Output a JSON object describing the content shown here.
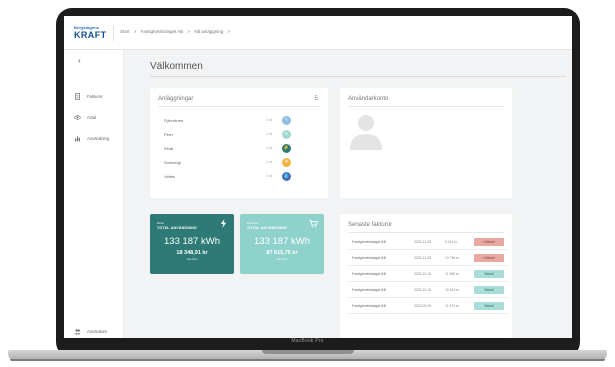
{
  "device": {
    "label": "MacBook Pro"
  },
  "colors": {
    "brand": "#13508f",
    "kpi_dark": "#2d7a76",
    "kpi_light": "#8fd2cc",
    "badge_paid": "#a9ddd7",
    "badge_unpaid": "#e8a8a2"
  },
  "topbar": {
    "logo_top": "Bergslagens",
    "logo_main": "KRAFT",
    "breadcrumb": [
      "Start",
      ">",
      "Fastighetsbolaget AB",
      ">",
      "Nå anläggning",
      ">"
    ]
  },
  "sidebar": {
    "collapse_icon": "chevron-left-icon",
    "items": [
      {
        "label": "Fakturor",
        "icon": "invoice-icon"
      },
      {
        "label": "Avtal",
        "icon": "eye-icon"
      },
      {
        "label": "Användning",
        "icon": "chart-icon"
      }
    ],
    "footer_label": "Användare"
  },
  "main": {
    "title": "Välkommen",
    "plants": {
      "heading": "Anläggningar",
      "count": "5",
      "rows": [
        {
          "name": "Fjärrvärme",
          "value": "1 st",
          "icon": "heat-icon",
          "color": "#8ebde0"
        },
        {
          "name": "Fiber",
          "value": "1 st",
          "icon": "fiber-icon",
          "color": "#a4d8d2"
        },
        {
          "name": "Elnät",
          "value": "1 st",
          "icon": "power-icon",
          "color": "#2d7a76"
        },
        {
          "name": "Solenergi",
          "value": "1 st",
          "icon": "sun-icon",
          "color": "#f0b442"
        },
        {
          "name": "Vatten",
          "value": "1 st",
          "icon": "water-icon",
          "color": "#4a6fb5"
        }
      ]
    },
    "user_card": {
      "heading": "Användarkonto"
    },
    "kpis": [
      {
        "small": "Elnät",
        "label": "TOTAL ANVÄNDNING",
        "value": "133 187 kWh",
        "sub": "18 348,91 kr",
        "sub2": "Jan-Dec",
        "icon": "lightning-icon"
      },
      {
        "small": "Elhandel",
        "label": "TOTAL ANVÄNDNING",
        "value": "133 187 kWh",
        "sub": "87 615,75 kr",
        "sub2": "Jan-Dec",
        "icon": "cart-icon"
      }
    ],
    "invoices": {
      "heading": "Senaste fakturor",
      "rows": [
        {
          "name": "Fastighetsbolaget AB",
          "date": "2023-11-30",
          "amount": "6 314 kr",
          "status": "Obetald",
          "paid": false
        },
        {
          "name": "Fastighetsbolaget AB",
          "date": "2023-11-30",
          "amount": "13 756 kr",
          "status": "Obetald",
          "paid": false
        },
        {
          "name": "Fastighetsbolaget AB",
          "date": "2023-10-31",
          "amount": "11 285 kr",
          "status": "Betald",
          "paid": true
        },
        {
          "name": "Fastighetsbolaget AB",
          "date": "2023-10-31",
          "amount": "18 512 kr",
          "status": "Betald",
          "paid": true
        },
        {
          "name": "Fastighetsbolaget AB",
          "date": "2023-09-30",
          "amount": "11 574 kr",
          "status": "Betald",
          "paid": true
        }
      ]
    }
  }
}
